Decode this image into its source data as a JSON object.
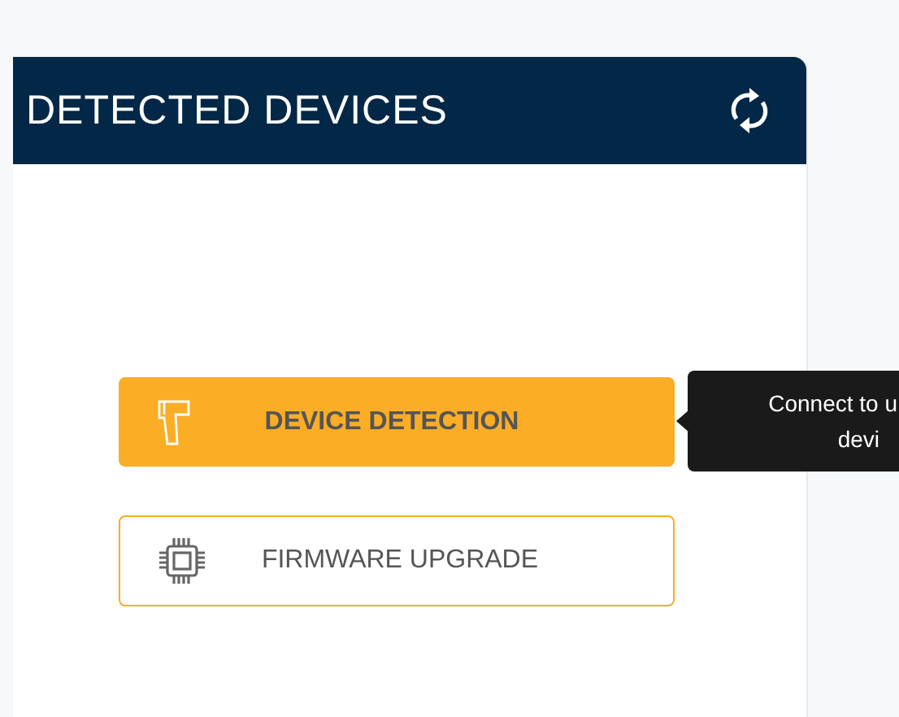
{
  "panel": {
    "title": "DETECTED DEVICES"
  },
  "buttons": [
    {
      "label": "DEVICE DETECTION",
      "kind": "scanner",
      "selected": true
    },
    {
      "label": "FIRMWARE UPGRADE",
      "kind": "chip",
      "selected": false
    }
  ],
  "tooltip": {
    "lines": [
      "Connect to u",
      "devi"
    ]
  }
}
